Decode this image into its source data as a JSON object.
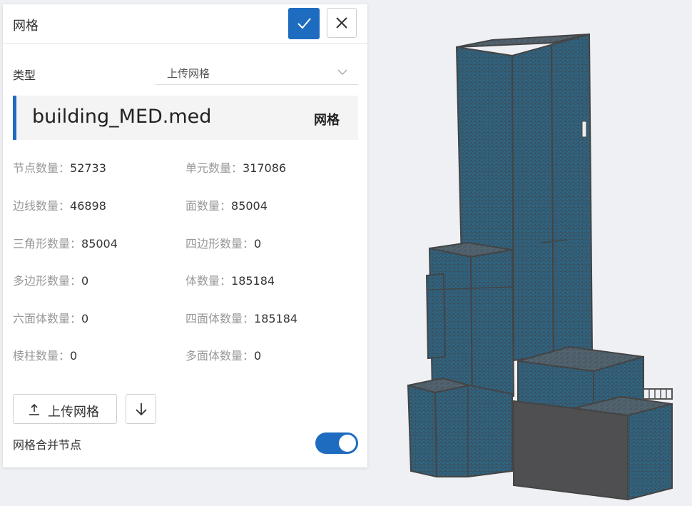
{
  "panel": {
    "title": "网格",
    "type_label": "类型",
    "type_value": "上传网格",
    "file_name": "building_MED.med",
    "file_type": "网格",
    "stats": [
      {
        "label": "节点数量：",
        "value": "52733"
      },
      {
        "label": "单元数量：",
        "value": "317086"
      },
      {
        "label": "边线数量：",
        "value": "46898"
      },
      {
        "label": "面数量：",
        "value": "85004"
      },
      {
        "label": "三角形数量：",
        "value": "85004"
      },
      {
        "label": "四边形数量：",
        "value": "0"
      },
      {
        "label": "多边形数量：",
        "value": "0"
      },
      {
        "label": "体数量：",
        "value": "185184"
      },
      {
        "label": "六面体数量：",
        "value": "0"
      },
      {
        "label": "四面体数量：",
        "value": "185184"
      },
      {
        "label": "棱柱数量：",
        "value": "0"
      },
      {
        "label": "多面体数量：",
        "value": "0"
      }
    ],
    "upload_label": "上传网格",
    "merge_label": "网格合并节点",
    "merge_enabled": true
  },
  "icons": {
    "confirm": "check-icon",
    "close": "close-icon",
    "dropdown": "chevron-down-icon",
    "upload": "upload-icon",
    "download": "arrow-down-icon"
  },
  "colors": {
    "accent": "#1e6cc0",
    "mesh_fill": "#2b6a8c",
    "mesh_line": "#4a4a4a"
  }
}
